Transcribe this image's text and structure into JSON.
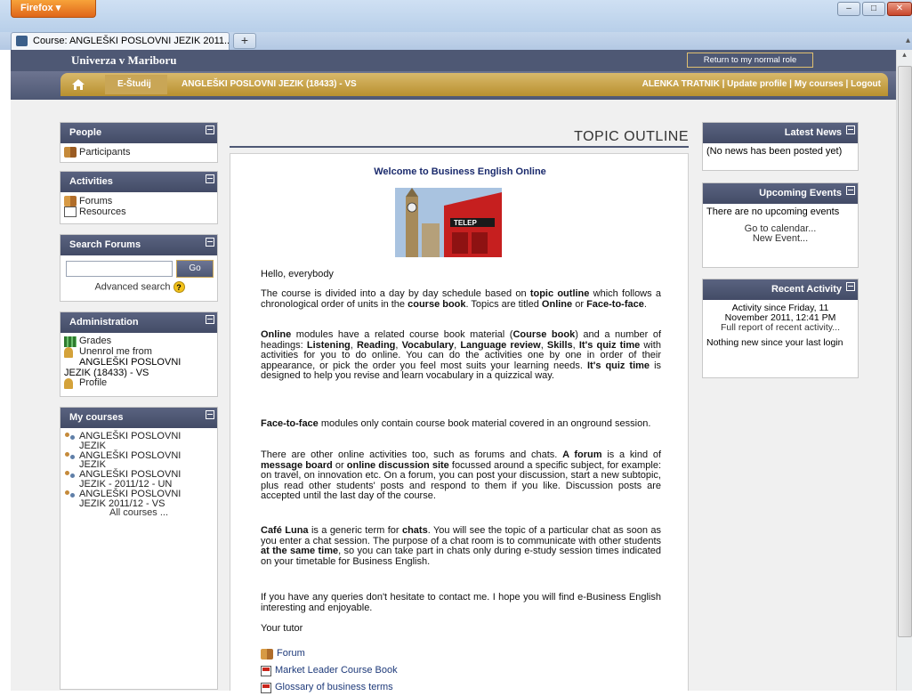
{
  "browser": {
    "app_button": "Firefox",
    "tab_title": "Course: ANGLEŠKI POSLOVNI JEZIK 2011...",
    "new_tab": "+"
  },
  "header": {
    "university": "Univerza v Mariboru",
    "role_button": "Return to my normal role",
    "breadcrumb_estudij": "E-Študij",
    "breadcrumb_course": "ANGLEŠKI POSLOVNI JEZIK (18433) - VS",
    "user_links": "ALENKA TRATNIK | Update profile | My courses | Logout"
  },
  "left": {
    "people": {
      "title": "People",
      "items": [
        "Participants"
      ]
    },
    "activities": {
      "title": "Activities",
      "items": [
        "Forums",
        "Resources"
      ]
    },
    "search": {
      "title": "Search Forums",
      "go": "Go",
      "advanced": "Advanced search",
      "help": "?"
    },
    "admin": {
      "title": "Administration",
      "grades": "Grades",
      "unenrol_1": "Unenrol me from",
      "unenrol_2": "ANGLEŠKI POSLOVNI",
      "unenrol_3": "JEZIK (18433) - VS",
      "profile": "Profile"
    },
    "mycourses": {
      "title": "My courses",
      "c1a": "ANGLEŠKI POSLOVNI",
      "c1b": "JEZIK",
      "c2a": "ANGLEŠKI POSLOVNI",
      "c2b": "JEZIK",
      "c3a": "ANGLEŠKI POSLOVNI",
      "c3b": "JEZIK - 2011/12 - UN",
      "c4a": "ANGLEŠKI POSLOVNI",
      "c4b": "JEZIK 2011/12 - VS",
      "all": "All courses ..."
    }
  },
  "main": {
    "topic_outline": "TOPIC OUTLINE",
    "welcome": "Welcome to Business English Online",
    "hello": "Hello, everybody",
    "p1": [
      "The course is divided into a day by day schedule based on ",
      "topic outline",
      " which follows a chronological order of units in the ",
      "course book",
      ". Topics are titled ",
      "Online",
      " or ",
      "Face-to-face",
      "."
    ],
    "p2": [
      "Online",
      " modules have a related course book material (",
      "Course book",
      ") and a number of headings: ",
      "Listening",
      ", ",
      "Reading",
      ", ",
      "Vocabulary",
      ", ",
      "Language review",
      ", ",
      "Skills",
      ", ",
      "It's quiz time",
      " with activities for you to do online. You can do the activities one by one in order of their appearance, or pick the order you feel most suits your learning needs. ",
      "It's quiz time",
      " is designed to help you revise and learn vocabulary in a quizzical way."
    ],
    "p3": [
      "Face-to-face",
      " modules only contain course book material covered in an onground session."
    ],
    "p4": [
      "There are other online activities too, such as forums and chats. ",
      "A forum",
      " is a kind of ",
      "message board",
      " or ",
      "online discussion site",
      " focussed around a specific subject, for example: on travel, on innovation etc. On a forum, you can post your discussion, start a new subtopic, plus read other students' posts and respond to them if you like. Discussion posts are accepted until the last day of the course."
    ],
    "p5": [
      "Café Luna",
      " is a generic term for ",
      "chats",
      ". You will see the topic of a particular chat as soon as you enter a chat session. The purpose of a chat room is to communicate with other students ",
      "at the same time",
      ", so you can take part in chats only during e-study session times indicated on your timetable for Business English."
    ],
    "p6": "If you have any queries don't hesitate to contact me. I hope you will find e-Business English interesting and enjoyable.",
    "tutor": "Your tutor",
    "links": [
      "Forum",
      "Market Leader Course Book",
      "Glossary of business terms"
    ]
  },
  "right": {
    "news": {
      "title": "Latest News",
      "text": "(No news has been posted yet)"
    },
    "events": {
      "title": "Upcoming Events",
      "text": "There are no upcoming events",
      "calendar": "Go to calendar...",
      "new_event": "New Event..."
    },
    "activity": {
      "title": "Recent Activity",
      "since_1": "Activity since Friday, 11",
      "since_2": "November 2011, 12:41 PM",
      "full_report": "Full report of recent activity...",
      "nothing": "Nothing new since your last login"
    }
  }
}
